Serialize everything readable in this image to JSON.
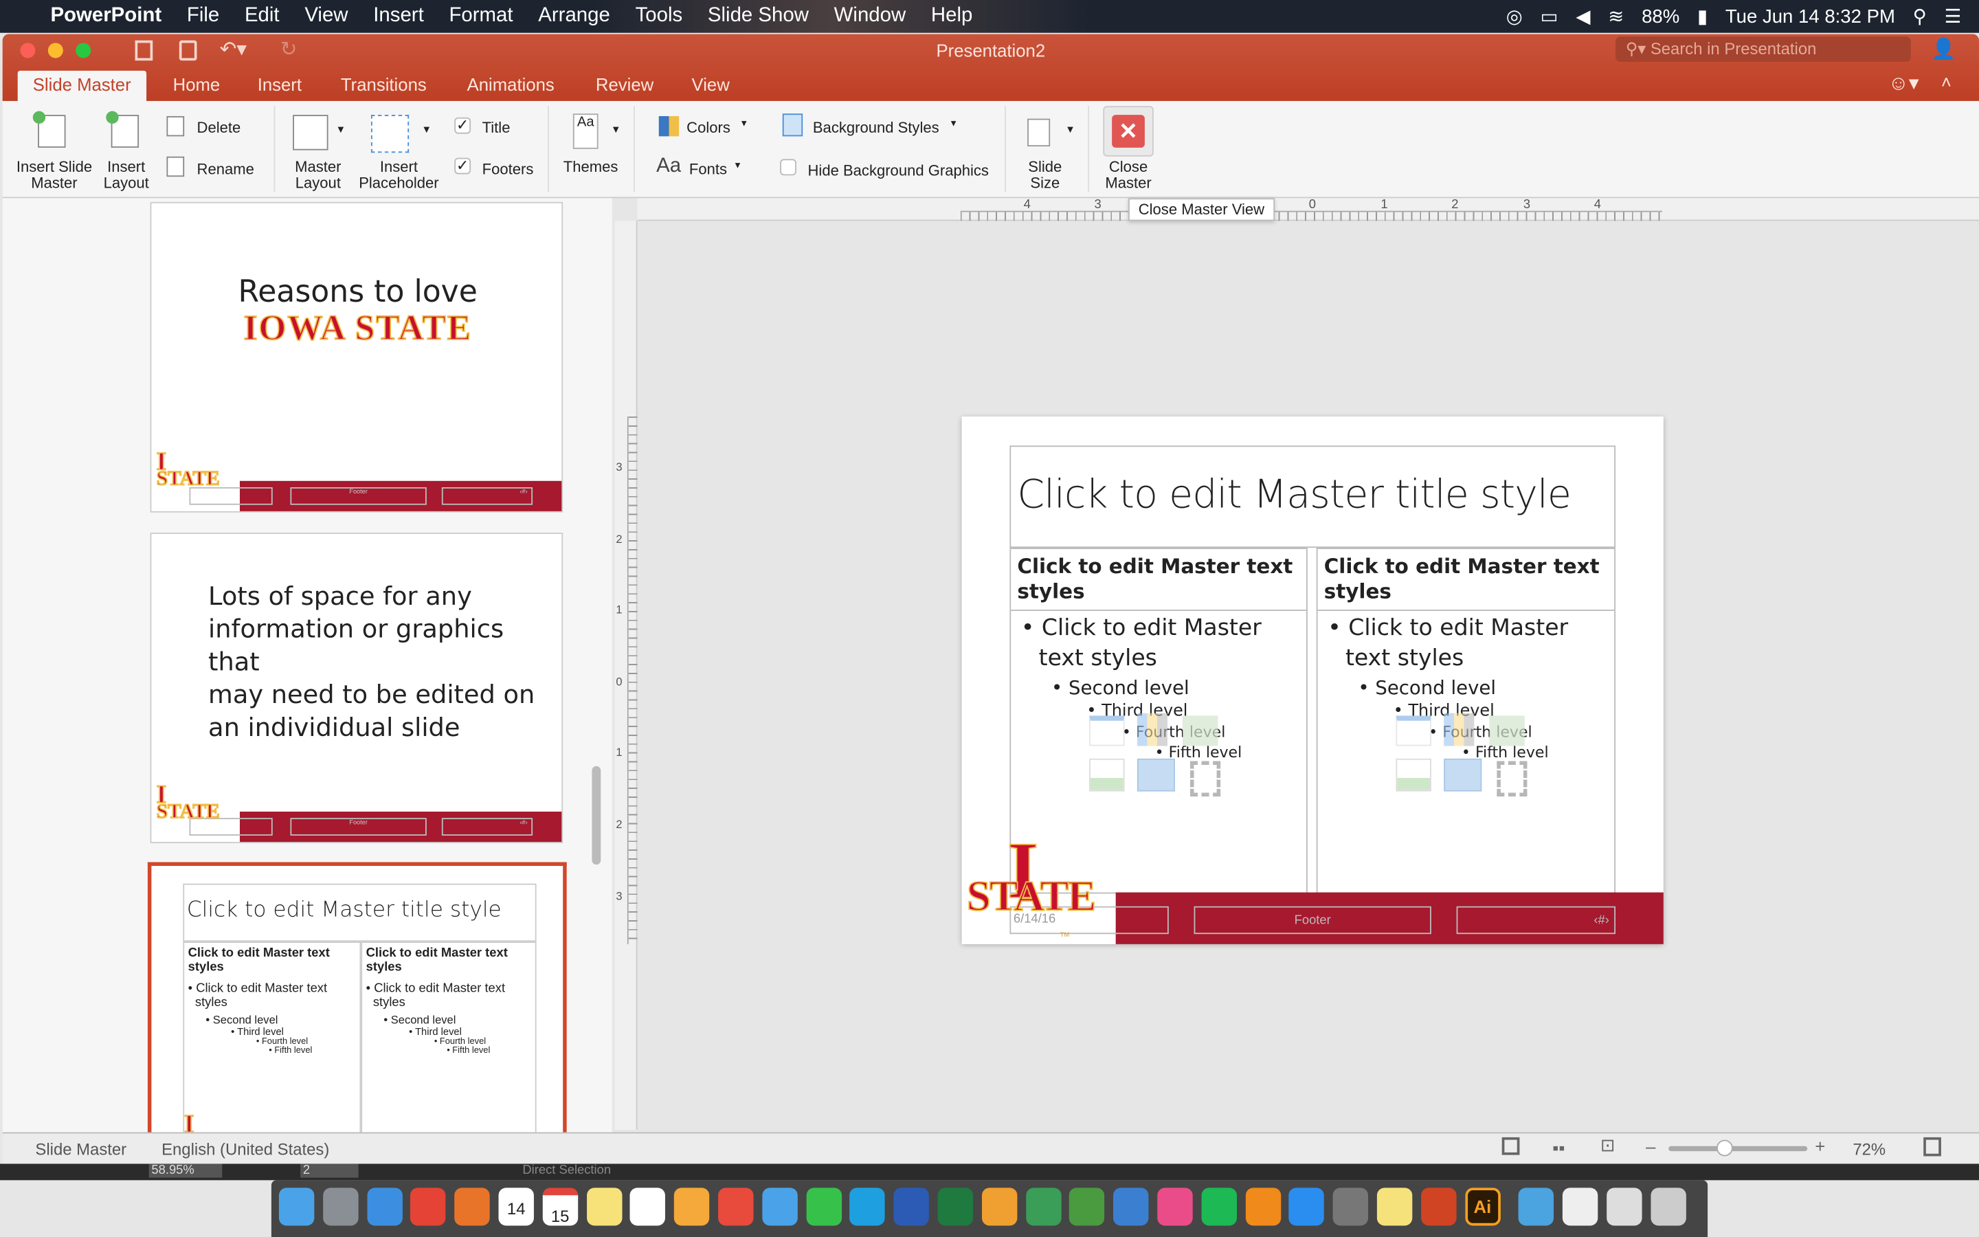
{
  "menubar": {
    "app": "PowerPoint",
    "items": [
      "File",
      "Edit",
      "View",
      "Insert",
      "Format",
      "Arrange",
      "Tools",
      "Slide Show",
      "Window",
      "Help"
    ],
    "battery": "88%",
    "clock": "Tue Jun 14  8:32 PM"
  },
  "window": {
    "title": "Presentation2",
    "search_placeholder": "Search in Presentation"
  },
  "tabs": [
    "Slide Master",
    "Home",
    "Insert",
    "Transitions",
    "Animations",
    "Review",
    "View"
  ],
  "ribbon": {
    "insert_slide_master": [
      "Insert Slide",
      "Master"
    ],
    "insert_layout": [
      "Insert",
      "Layout"
    ],
    "delete": "Delete",
    "rename": "Rename",
    "master_layout": [
      "Master",
      "Layout"
    ],
    "insert_placeholder": [
      "Insert",
      "Placeholder"
    ],
    "title": "Title",
    "footers": "Footers",
    "themes": "Themes",
    "colors": "Colors",
    "fonts": "Fonts",
    "fonts_glyph": "Aa",
    "background_styles": "Background Styles",
    "hide_background_graphics": "Hide Background Graphics",
    "slide_size": [
      "Slide",
      "Size"
    ],
    "close_master": [
      "Close",
      "Master"
    ],
    "title_checked": true,
    "footers_checked": true,
    "hide_bg_checked": false
  },
  "tooltip": "Close Master View",
  "ruler": {
    "h": [
      "4",
      "3",
      "2",
      "1",
      "0",
      "1",
      "2",
      "3",
      "4"
    ],
    "v": [
      "3",
      "2",
      "1",
      "0",
      "1",
      "2",
      "3"
    ]
  },
  "thumbnails": [
    {
      "title_line1": "Reasons to love",
      "title_line2": "IOWA STATE",
      "footer": "Footer",
      "num": "‹#›"
    },
    {
      "body": [
        "Lots of space for any",
        "information or graphics that",
        "may need to be edited on",
        "an individidual slide"
      ],
      "footer": "Footer",
      "num": "‹#›"
    },
    {
      "title": "Click to edit Master title style",
      "col_head": [
        "Click to edit Master text",
        "styles"
      ],
      "l1": [
        "Click to edit Master text",
        "styles"
      ],
      "l2": "Second level",
      "l3": "Third level",
      "l4": "Fourth level",
      "l5": "Fifth level"
    }
  ],
  "slide": {
    "title": "Click to edit Master title style",
    "col_head": "Click to edit Master text styles",
    "level1": "Click to edit Master text styles",
    "level2": "Second level",
    "level3": "Third level",
    "level4": "Fourth level",
    "level5": "Fifth level",
    "date": "6/14/16",
    "footer": "Footer",
    "num": "‹#›",
    "logo": "STATE",
    "tm": "TM"
  },
  "status": {
    "view": "Slide Master",
    "language": "English (United States)",
    "zoom": "72%",
    "zoom_fraction": 0.4
  },
  "illustrator_bar": {
    "zoom": "58.95%",
    "page": "2",
    "tool": "Direct Selection"
  },
  "dock": [
    "Finder",
    "Launchpad",
    "Safari",
    "Chrome",
    "Firefox",
    "Calendar",
    "Calendar 15",
    "Notes",
    "Reminders",
    "Photos",
    "Gmail",
    "Messages",
    "FaceTime",
    "Skype",
    "Word",
    "Excel",
    "Pages",
    "Google Drive",
    "Numbers",
    "Keynote",
    "iTunes",
    "Spotify",
    "iBooks",
    "App Store",
    "System Preferences",
    "Stickies",
    "PowerPoint",
    "Illustrator",
    "Downloads",
    "Document",
    "Preview",
    "Trash"
  ],
  "dock_labels": {
    "calendar_day": "14",
    "calendar2_day": "15",
    "ai": "Ai"
  },
  "colors": {
    "accent": "#c44d34",
    "cardinal": "#a6192e",
    "gold": "#f1be48"
  }
}
